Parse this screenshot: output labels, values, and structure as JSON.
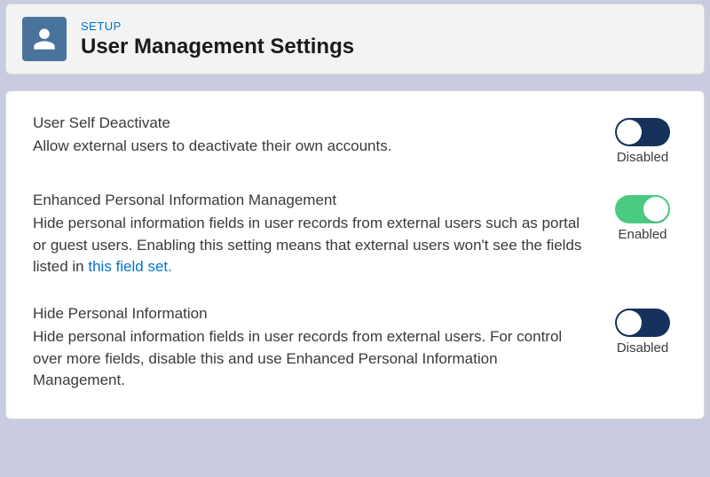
{
  "header": {
    "eyebrow": "SETUP",
    "title": "User Management Settings"
  },
  "toggle_labels": {
    "enabled": "Enabled",
    "disabled": "Disabled"
  },
  "settings": [
    {
      "id": "user-self-deactivate",
      "title": "User Self Deactivate",
      "description": "Allow external users to deactivate their own accounts.",
      "link_text": "",
      "state": "off"
    },
    {
      "id": "enhanced-personal-info",
      "title": "Enhanced Personal Information Management",
      "description": "Hide personal information fields in user records from external users such as portal or guest users. Enabling this setting means that external users won't see the fields listed in ",
      "link_text": "this field set.",
      "state": "on"
    },
    {
      "id": "hide-personal-info",
      "title": "Hide Personal Information",
      "description": "Hide personal information fields in user records from external users. For control over more fields, disable this and use Enhanced Personal Information Management.",
      "link_text": "",
      "state": "off"
    }
  ]
}
